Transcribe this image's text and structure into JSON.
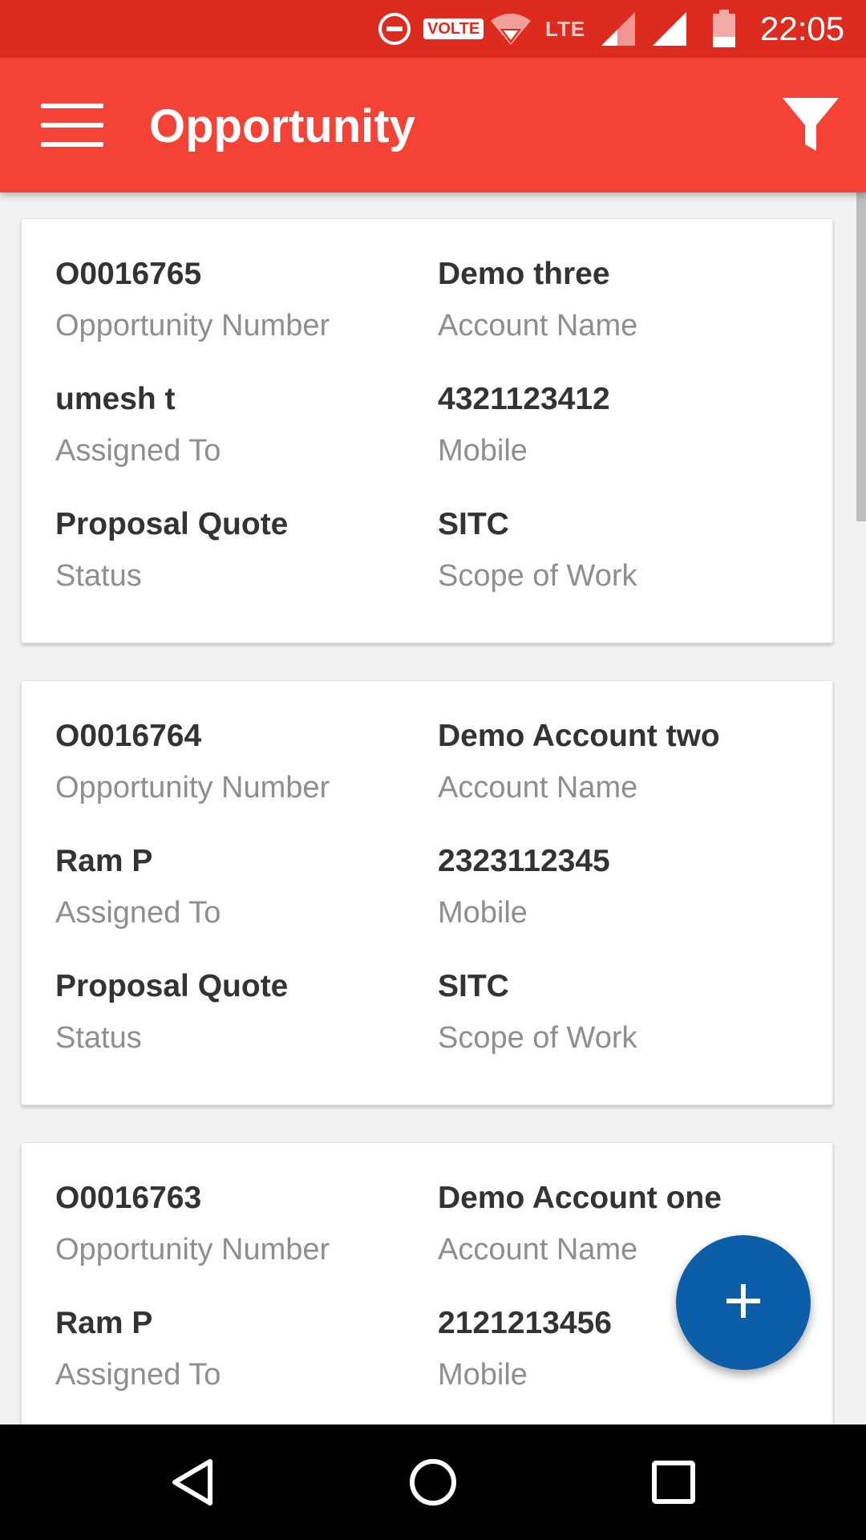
{
  "status_bar": {
    "time": "22:05",
    "network_type": "LTE",
    "volte": "VOLTE",
    "icons": [
      "do-not-disturb-icon",
      "volte-icon",
      "wifi-icon",
      "signal-icon",
      "signal-icon",
      "battery-low-icon"
    ]
  },
  "app_bar": {
    "title": "Opportunity",
    "menu_icon": "hamburger-menu-icon",
    "filter_icon": "filter-icon",
    "color": "#f44336"
  },
  "opportunities": [
    {
      "opportunity_number": "O0016765",
      "opportunity_number_label": "Opportunity Number",
      "account_name": "Demo three",
      "account_name_label": "Account Name",
      "assigned_to": "umesh t",
      "assigned_to_label": "Assigned To",
      "mobile": "4321123412",
      "mobile_label": "Mobile",
      "status": "Proposal Quote",
      "status_label": "Status",
      "scope_of_work": "SITC",
      "scope_of_work_label": "Scope of Work"
    },
    {
      "opportunity_number": "O0016764",
      "opportunity_number_label": "Opportunity Number",
      "account_name": "Demo Account two",
      "account_name_label": "Account Name",
      "assigned_to": "Ram P",
      "assigned_to_label": "Assigned To",
      "mobile": "2323112345",
      "mobile_label": "Mobile",
      "status": "Proposal Quote",
      "status_label": "Status",
      "scope_of_work": "SITC",
      "scope_of_work_label": "Scope of Work"
    },
    {
      "opportunity_number": "O0016763",
      "opportunity_number_label": "Opportunity Number",
      "account_name": "Demo Account one",
      "account_name_label": "Account Name",
      "assigned_to": "Ram P",
      "assigned_to_label": "Assigned To",
      "mobile": "2121213456",
      "mobile_label": "Mobile"
    }
  ],
  "fab": {
    "icon": "plus-icon",
    "color": "#0d5ea8"
  },
  "nav_bar": {
    "back_icon": "back-triangle-icon",
    "home_icon": "home-circle-icon",
    "recent_icon": "recent-apps-square-icon"
  }
}
